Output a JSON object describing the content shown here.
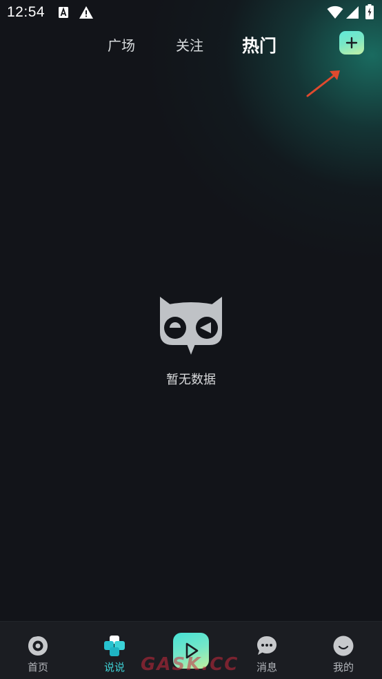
{
  "status_bar": {
    "time": "12:54",
    "icons": [
      "text-a-icon",
      "warning-icon",
      "wifi-icon",
      "signal-icon",
      "battery-charging-icon"
    ]
  },
  "top_tabs": {
    "items": [
      {
        "label": "广场",
        "active": false
      },
      {
        "label": "关注",
        "active": false
      },
      {
        "label": "热门",
        "active": true
      }
    ],
    "add_icon": "plus-icon"
  },
  "empty_state": {
    "icon": "owl-icon",
    "text": "暂无数据"
  },
  "bottom_nav": {
    "items": [
      {
        "label": "首页",
        "icon": "home-ring-icon",
        "active": false
      },
      {
        "label": "说说",
        "icon": "cubes-icon",
        "active": true
      },
      {
        "label": "",
        "icon": "play-icon",
        "active": false
      },
      {
        "label": "消息",
        "icon": "chat-bubble-icon",
        "active": false
      },
      {
        "label": "我的",
        "icon": "smile-face-icon",
        "active": false
      }
    ]
  },
  "watermark": "GASK.CC",
  "colors": {
    "background": "#121419",
    "accent": "#3fd2d6",
    "nav_background": "#1b1d22",
    "arrow_annotation": "#e04a2e"
  }
}
